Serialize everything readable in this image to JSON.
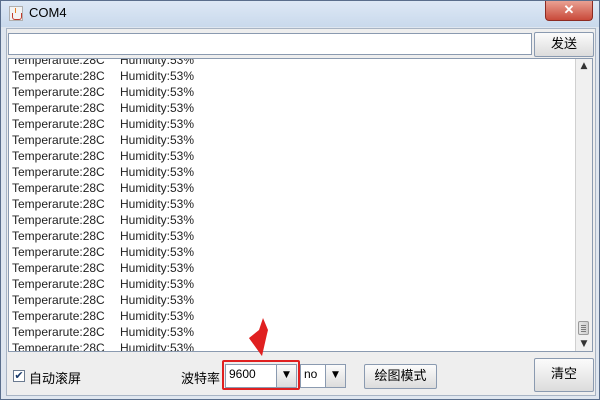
{
  "window": {
    "title": "COM4",
    "close_glyph": "✕"
  },
  "toolbar": {
    "send_input_value": "",
    "send_label": "发送"
  },
  "monitor": {
    "lines": [
      {
        "temp": "Temperarute:28C",
        "hum": "Humidity:53%"
      },
      {
        "temp": "Temperarute:28C",
        "hum": "Humidity:53%"
      },
      {
        "temp": "Temperarute:28C",
        "hum": "Humidity:53%"
      },
      {
        "temp": "Temperarute:28C",
        "hum": "Humidity:53%"
      },
      {
        "temp": "Temperarute:28C",
        "hum": "Humidity:53%"
      },
      {
        "temp": "Temperarute:28C",
        "hum": "Humidity:53%"
      },
      {
        "temp": "Temperarute:28C",
        "hum": "Humidity:53%"
      },
      {
        "temp": "Temperarute:28C",
        "hum": "Humidity:53%"
      },
      {
        "temp": "Temperarute:28C",
        "hum": "Humidity:53%"
      },
      {
        "temp": "Temperarute:28C",
        "hum": "Humidity:53%"
      },
      {
        "temp": "Temperarute:28C",
        "hum": "Humidity:53%"
      },
      {
        "temp": "Temperarute:28C",
        "hum": "Humidity:53%"
      },
      {
        "temp": "Temperarute:28C",
        "hum": "Humidity:53%"
      },
      {
        "temp": "Temperarute:28C",
        "hum": "Humidity:53%"
      },
      {
        "temp": "Temperarute:28C",
        "hum": "Humidity:53%"
      },
      {
        "temp": "Temperarute:28C",
        "hum": "Humidity:53%"
      },
      {
        "temp": "Temperarute:28C",
        "hum": "Humidity:53%"
      },
      {
        "temp": "Temperarute:28C",
        "hum": "Humidity:53%"
      },
      {
        "temp": "Temperarute:28C",
        "hum": "Humidity:53%"
      }
    ]
  },
  "footer": {
    "autoscroll_label": "自动滚屏",
    "autoscroll_checked": true,
    "baud_label": "波特率",
    "baud_value": "9600",
    "line_ending_value": "no",
    "plot_label": "绘图模式",
    "clear_label": "清空"
  },
  "colors": {
    "highlight": "#e02020",
    "close_button": "#c94a3a"
  }
}
